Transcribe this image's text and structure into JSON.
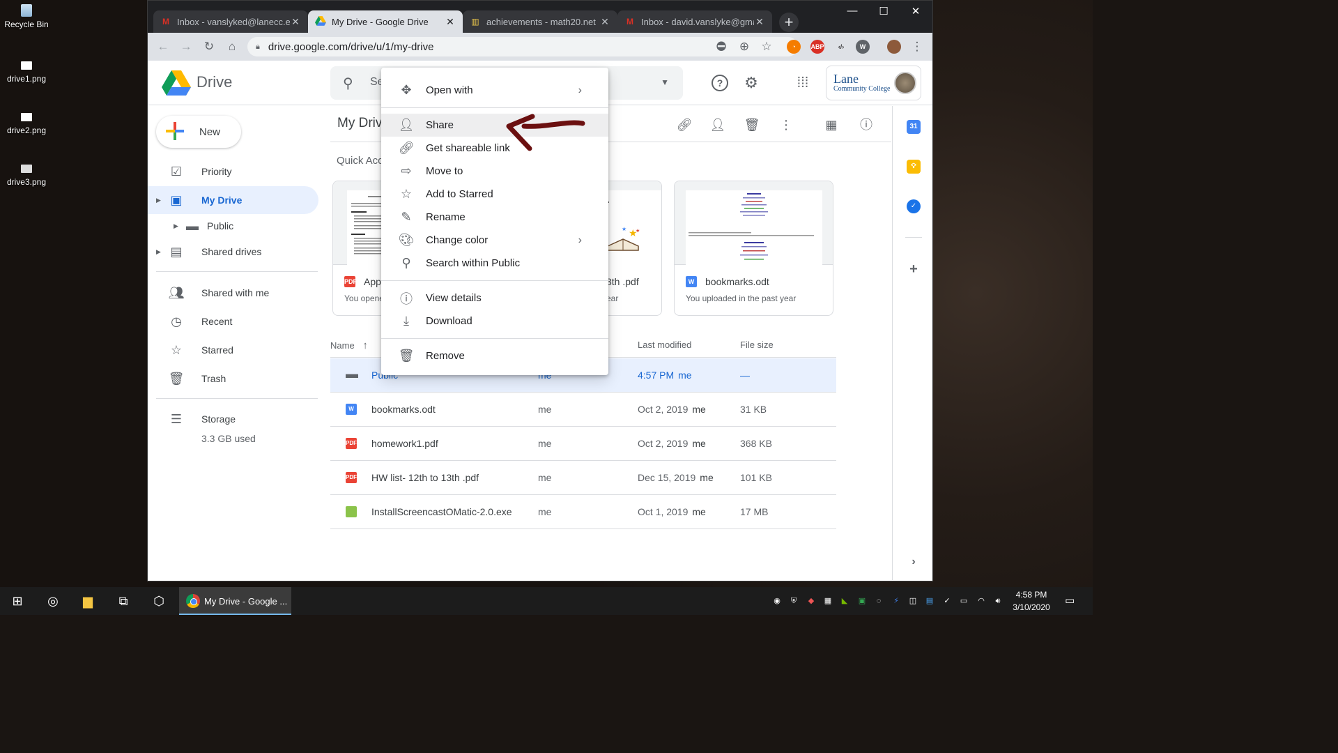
{
  "desktop": {
    "icons": [
      {
        "label": "Recycle Bin",
        "icon": "recycle-bin-icon"
      },
      {
        "label": "drive1.png",
        "icon": "image-file-icon"
      },
      {
        "label": "drive2.png",
        "icon": "image-file-icon"
      },
      {
        "label": "drive3.png",
        "icon": "image-file-icon"
      }
    ]
  },
  "browser": {
    "tabs": [
      {
        "title": "Inbox - vanslyked@lanecc.ed",
        "favicon": "gmail-icon",
        "active": false
      },
      {
        "title": "My Drive - Google Drive",
        "favicon": "drive-icon",
        "active": true
      },
      {
        "title": "achievements - math20.net",
        "favicon": "math20-icon",
        "active": false
      },
      {
        "title": "Inbox - david.vanslyke@gma",
        "favicon": "gmail-icon",
        "active": false
      }
    ],
    "url": "drive.google.com/drive/u/1/my-drive"
  },
  "drive": {
    "app_name": "Drive",
    "search_placeholder": "Se",
    "account_org": "Lane",
    "account_org_sub": "Community College",
    "new_label": "New",
    "nav": {
      "priority": "Priority",
      "my_drive": "My Drive",
      "public": "Public",
      "shared_drives": "Shared drives",
      "shared_with_me": "Shared with me",
      "recent": "Recent",
      "starred": "Starred",
      "trash": "Trash",
      "storage": "Storage",
      "storage_used": "3.3 GB used"
    },
    "breadcrumb": "My Drive",
    "quick_access_title": "Quick Acc",
    "quick_access": [
      {
        "name": "App",
        "sub": "You opene",
        "type": "PDF"
      },
      {
        "name": "3th .pdf",
        "sub": "ear",
        "type": "PDF"
      },
      {
        "name": "bookmarks.odt",
        "sub": "You uploaded in the past year",
        "type": "W"
      }
    ],
    "columns": {
      "name": "Name",
      "owner": "",
      "modified": "Last modified",
      "size": "File size"
    },
    "files": [
      {
        "name": "Public",
        "owner": "me",
        "modified": "4:57 PM",
        "modified_by": "me",
        "size": "—",
        "type": "folder"
      },
      {
        "name": "bookmarks.odt",
        "owner": "me",
        "modified": "Oct 2, 2019",
        "modified_by": "me",
        "size": "31 KB",
        "type": "W"
      },
      {
        "name": "homework1.pdf",
        "owner": "me",
        "modified": "Oct 2, 2019",
        "modified_by": "me",
        "size": "368 KB",
        "type": "PDF"
      },
      {
        "name": "HW list- 12th to 13th .pdf",
        "owner": "me",
        "modified": "Dec 15, 2019",
        "modified_by": "me",
        "size": "101 KB",
        "type": "PDF"
      },
      {
        "name": "InstallScreencastOMatic-2.0.exe",
        "owner": "me",
        "modified": "Oct 1, 2019",
        "modified_by": "me",
        "size": "17 MB",
        "type": "exe"
      }
    ]
  },
  "context_menu": {
    "open_with": "Open with",
    "share": "Share",
    "get_link": "Get shareable link",
    "move_to": "Move to",
    "add_starred": "Add to Starred",
    "rename": "Rename",
    "change_color": "Change color",
    "search_within": "Search within Public",
    "view_details": "View details",
    "download": "Download",
    "remove": "Remove"
  },
  "taskbar": {
    "active_app": "My Drive - Google ...",
    "time": "4:58 PM",
    "date": "3/10/2020"
  },
  "colors": {
    "accent": "#1967d2",
    "selected_bg": "#e8f0fe",
    "annotation_arrow": "#6b1010"
  }
}
